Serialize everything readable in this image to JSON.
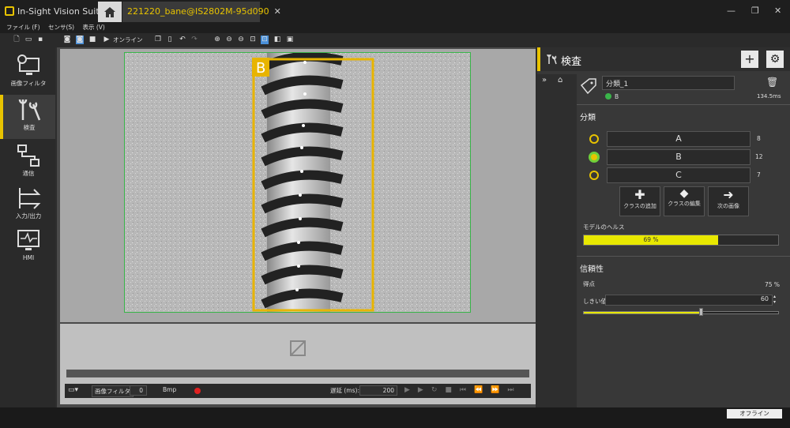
{
  "app": {
    "title": "In-Sight Vision Suite",
    "tab_title": "221220_bane@IS2802M-95d090",
    "tab_close": "✕"
  },
  "window": {
    "minimize": "—",
    "maximize": "❐",
    "close": "✕"
  },
  "menu": [
    "ファイル (F)",
    "センサ(S)",
    "表示 (V)"
  ],
  "toolbar": {
    "online_label": "オンライン"
  },
  "nav": [
    {
      "label": "画像フィルタ"
    },
    {
      "label": "検査"
    },
    {
      "label": "通信"
    },
    {
      "label": "入力/出力"
    },
    {
      "label": "HMI"
    }
  ],
  "image": {
    "box_label": "B"
  },
  "bottom_bar": {
    "filter_label": "画像フィルタ",
    "filter_value": "0",
    "format": "Bmp",
    "delay_label": "遅延 (ms):",
    "delay_value": "200"
  },
  "panel": {
    "title": "検査",
    "tool_name": "分類_1",
    "tool_result": "B",
    "time": "134.5ms",
    "section_classify": "分類",
    "classes": [
      {
        "name": "A",
        "count": "8",
        "selected": false
      },
      {
        "name": "B",
        "count": "12",
        "selected": true
      },
      {
        "name": "C",
        "count": "7",
        "selected": false
      }
    ],
    "actions": [
      {
        "label": "クラスの追加"
      },
      {
        "label": "クラスの編集"
      },
      {
        "label": "次の画像"
      }
    ],
    "health_label": "モデルのヘルス",
    "health_value": "69 %",
    "health_fraction": 0.69,
    "section_reliability": "信頼性",
    "score_label": "得点",
    "score_value": "75 %",
    "threshold_label": "しきい値",
    "threshold_value": "60",
    "threshold_fraction": 0.6
  },
  "status": {
    "mode": "オフライン"
  },
  "colors": {
    "accent": "#e8c300",
    "ok": "#3ab54a",
    "bg": "#383838"
  }
}
